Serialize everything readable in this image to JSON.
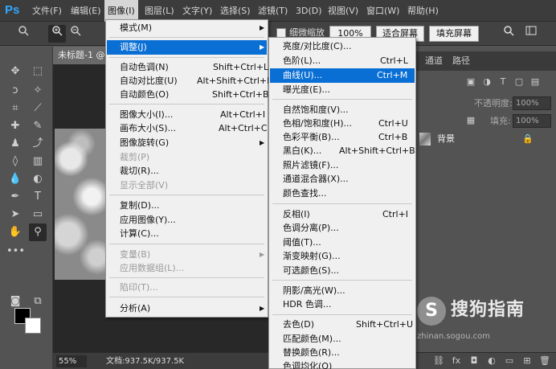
{
  "app": {
    "logo": "Ps"
  },
  "menubar": {
    "items": [
      {
        "label": "文件(F)"
      },
      {
        "label": "编辑(E)"
      },
      {
        "label": "图像(I)"
      },
      {
        "label": "图层(L)"
      },
      {
        "label": "文字(Y)"
      },
      {
        "label": "选择(S)"
      },
      {
        "label": "滤镜(T)"
      },
      {
        "label": "3D(D)"
      },
      {
        "label": "视图(V)"
      },
      {
        "label": "窗口(W)"
      },
      {
        "label": "帮助(H)"
      }
    ],
    "active": "图像(I)"
  },
  "options": {
    "scrubby_zoom_label": "细微缩放",
    "zoom_100": "100%",
    "fit_screen": "适合屏幕",
    "fill_screen": "填充屏幕"
  },
  "document": {
    "tab_title": "未标题-1 @",
    "zoom": "55%",
    "info": "文档:937.5K/937.5K"
  },
  "panels": {
    "tabs": [
      "通道",
      "路径"
    ],
    "opacity_label": "不透明度:",
    "opacity_value": "100%",
    "fill_label": "填充:",
    "fill_value": "100%",
    "layer_name": "背景",
    "fx_label": "fx"
  },
  "image_menu": {
    "items": [
      {
        "label": "模式(M)",
        "shortcut": "",
        "arrow": true,
        "disabled": false,
        "highlight": false
      },
      {
        "label": "调整(J)",
        "shortcut": "",
        "arrow": true,
        "disabled": false,
        "highlight": true
      },
      {
        "label": "自动色调(N)",
        "shortcut": "Shift+Ctrl+L",
        "arrow": false,
        "disabled": false,
        "highlight": false
      },
      {
        "label": "自动对比度(U)",
        "shortcut": "Alt+Shift+Ctrl+L",
        "arrow": false,
        "disabled": false,
        "highlight": false
      },
      {
        "label": "自动颜色(O)",
        "shortcut": "Shift+Ctrl+B",
        "arrow": false,
        "disabled": false,
        "highlight": false
      },
      {
        "label": "图像大小(I)...",
        "shortcut": "Alt+Ctrl+I",
        "arrow": false,
        "disabled": false,
        "highlight": false
      },
      {
        "label": "画布大小(S)...",
        "shortcut": "Alt+Ctrl+C",
        "arrow": false,
        "disabled": false,
        "highlight": false
      },
      {
        "label": "图像旋转(G)",
        "shortcut": "",
        "arrow": true,
        "disabled": false,
        "highlight": false
      },
      {
        "label": "裁剪(P)",
        "shortcut": "",
        "arrow": false,
        "disabled": true,
        "highlight": false
      },
      {
        "label": "裁切(R)...",
        "shortcut": "",
        "arrow": false,
        "disabled": false,
        "highlight": false
      },
      {
        "label": "显示全部(V)",
        "shortcut": "",
        "arrow": false,
        "disabled": true,
        "highlight": false
      },
      {
        "label": "复制(D)...",
        "shortcut": "",
        "arrow": false,
        "disabled": false,
        "highlight": false
      },
      {
        "label": "应用图像(Y)...",
        "shortcut": "",
        "arrow": false,
        "disabled": false,
        "highlight": false
      },
      {
        "label": "计算(C)...",
        "shortcut": "",
        "arrow": false,
        "disabled": false,
        "highlight": false
      },
      {
        "label": "变量(B)",
        "shortcut": "",
        "arrow": true,
        "disabled": true,
        "highlight": false
      },
      {
        "label": "应用数据组(L)...",
        "shortcut": "",
        "arrow": false,
        "disabled": true,
        "highlight": false
      },
      {
        "label": "陷印(T)...",
        "shortcut": "",
        "arrow": false,
        "disabled": true,
        "highlight": false
      },
      {
        "label": "分析(A)",
        "shortcut": "",
        "arrow": true,
        "disabled": false,
        "highlight": false
      }
    ]
  },
  "adjust_menu": {
    "items": [
      {
        "label": "亮度/对比度(C)...",
        "shortcut": "",
        "highlight": false
      },
      {
        "label": "色阶(L)...",
        "shortcut": "Ctrl+L",
        "highlight": false
      },
      {
        "label": "曲线(U)...",
        "shortcut": "Ctrl+M",
        "highlight": true
      },
      {
        "label": "曝光度(E)...",
        "shortcut": "",
        "highlight": false
      },
      {
        "label": "自然饱和度(V)...",
        "shortcut": "",
        "highlight": false
      },
      {
        "label": "色相/饱和度(H)...",
        "shortcut": "Ctrl+U",
        "highlight": false
      },
      {
        "label": "色彩平衡(B)...",
        "shortcut": "Ctrl+B",
        "highlight": false
      },
      {
        "label": "黑白(K)...",
        "shortcut": "Alt+Shift+Ctrl+B",
        "highlight": false
      },
      {
        "label": "照片滤镜(F)...",
        "shortcut": "",
        "highlight": false
      },
      {
        "label": "通道混合器(X)...",
        "shortcut": "",
        "highlight": false
      },
      {
        "label": "颜色查找...",
        "shortcut": "",
        "highlight": false
      },
      {
        "label": "反相(I)",
        "shortcut": "Ctrl+I",
        "highlight": false
      },
      {
        "label": "色调分离(P)...",
        "shortcut": "",
        "highlight": false
      },
      {
        "label": "阈值(T)...",
        "shortcut": "",
        "highlight": false
      },
      {
        "label": "渐变映射(G)...",
        "shortcut": "",
        "highlight": false
      },
      {
        "label": "可选颜色(S)...",
        "shortcut": "",
        "highlight": false
      },
      {
        "label": "阴影/高光(W)...",
        "shortcut": "",
        "highlight": false
      },
      {
        "label": "HDR 色调...",
        "shortcut": "",
        "highlight": false
      },
      {
        "label": "去色(D)",
        "shortcut": "Shift+Ctrl+U",
        "highlight": false
      },
      {
        "label": "匹配颜色(M)...",
        "shortcut": "",
        "highlight": false
      },
      {
        "label": "替换颜色(R)...",
        "shortcut": "",
        "highlight": false
      },
      {
        "label": "色调均化(Q)",
        "shortcut": "",
        "highlight": false
      }
    ]
  },
  "watermark": {
    "logo_letter": "S",
    "text": "搜狗指南",
    "url": "zhinan.sogou.com"
  },
  "icons": {
    "search": "search-icon",
    "zoom_in": "zoom-in-icon",
    "zoom_out": "zoom-out-icon",
    "lock": "lock-icon",
    "eye": "eye-icon"
  }
}
